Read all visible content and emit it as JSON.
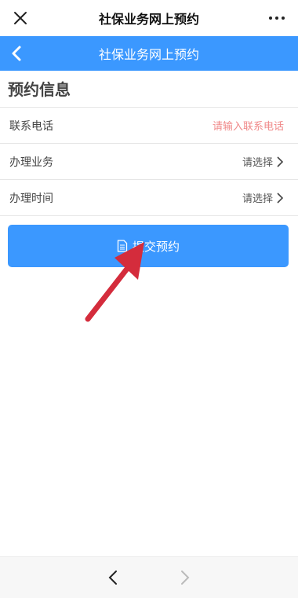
{
  "topbar": {
    "title": "社保业务网上预约",
    "close_icon": "close-icon",
    "more_icon": "more-dots-icon"
  },
  "header": {
    "title": "社保业务网上预约",
    "back_icon": "chevron-left-icon"
  },
  "section": {
    "title": "预约信息"
  },
  "form": {
    "phone": {
      "label": "联系电话",
      "placeholder": "请输入联系电话"
    },
    "service": {
      "label": "办理业务",
      "value": "请选择"
    },
    "time": {
      "label": "办理时间",
      "value": "请选择"
    }
  },
  "submit": {
    "label": "提交预约",
    "icon": "document-icon"
  },
  "bottom_nav": {
    "back_icon": "chevron-left-icon",
    "forward_icon": "chevron-right-icon"
  },
  "colors": {
    "primary": "#3b98ff",
    "placeholder_red": "#f08a8a",
    "annotation_arrow": "#d42c3c"
  }
}
